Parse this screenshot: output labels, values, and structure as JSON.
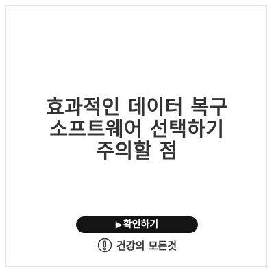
{
  "title": {
    "line1": "효과적인 데이터 복구",
    "line2": "소프트웨어 선택하기",
    "line3": "주의할 점"
  },
  "cta": {
    "arrow": "▶",
    "label": "확인하기"
  },
  "site": {
    "logo_icon": "exclamation-circle-icon",
    "name": "건강의 모든것"
  },
  "colors": {
    "background": "#ffffff",
    "title_text": "#333333",
    "button_bg": "#141414",
    "button_text": "#ffffff",
    "frame_border": "#e4e4e4"
  }
}
